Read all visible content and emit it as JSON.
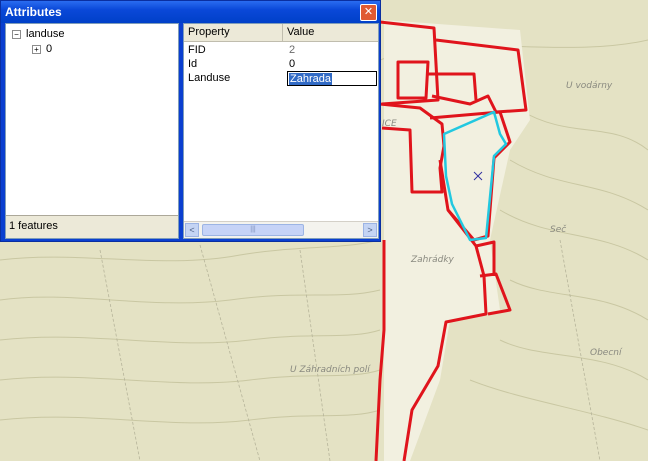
{
  "window": {
    "title": "Attributes",
    "close_glyph": "✕"
  },
  "tree": {
    "root_label": "landuse",
    "root_toggle": "−",
    "child_label": "0",
    "child_toggle": "+"
  },
  "status": {
    "feature_count": "1 features"
  },
  "grid": {
    "headers": [
      "Property",
      "Value"
    ],
    "rows": [
      {
        "property": "FID",
        "value": "2"
      },
      {
        "property": "Id",
        "value": "0"
      },
      {
        "property": "Landuse",
        "value": "Zahrada"
      }
    ]
  },
  "scrollbar": {
    "left_arrow": "<",
    "right_arrow": ">",
    "thumb_grip": "|||"
  },
  "map": {
    "labels": [
      "ICE",
      "Zahrádky",
      "U vodárny",
      "Seč",
      "U Záhradních polí",
      "Obecní"
    ],
    "parcel_color": "#e0141c",
    "selection_color": "#22c8e0",
    "background_color": "#e4e2c4"
  }
}
